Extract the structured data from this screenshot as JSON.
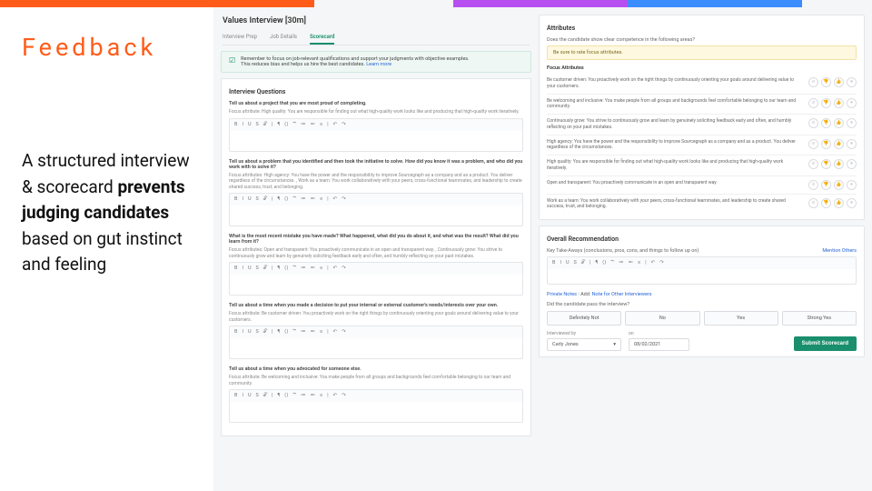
{
  "topbar": {
    "c1": "#ff5c1a",
    "c2": "#b74ff0",
    "c3": "#3a8cff"
  },
  "slide": {
    "title": "Feedback",
    "body_prefix": "A structured interview & scorecard ",
    "body_bold": "prevents judging candidates",
    "body_suffix": " based on gut instinct and feeling"
  },
  "app": {
    "title": "Values Interview [30m]",
    "tabs": [
      "Interview Prep",
      "Job Details",
      "Scorecard"
    ],
    "active_tab": 2,
    "info_line1": "Remember to focus on job-relevant qualifications and support your judgments with objective examples.",
    "info_line2": "This reduces bias and helps us hire the best candidates.",
    "learn_more": "Learn more",
    "iq_head": "Interview Questions",
    "questions": [
      {
        "q": "Tell us about a project that you are most proud of completing.",
        "sub": "Focus attribute: High quality: You are responsible for finding out what high-quality work looks like and producing that high-quality work iteratively."
      },
      {
        "q": "Tell us about a problem that you identified and then took the initiative to solve. How did you know it was a problem, and who did you work with to solve it?",
        "sub": "Focus attributes: High agency: You have the power and the responsibility to improve Sourcegraph as a company and as a product. You deliver regardless of the circumstances. , Work as a team: You work collaboratively with your peers, cross-functional teammates, and leadership to create shared success, trust, and belonging."
      },
      {
        "q": "What is the most recent mistake you have made? What happened, what did you do about it, and what was the result? What did you learn from it?",
        "sub": "Focus attributes: Open and transparent: You proactively communicate in an open and transparent way. , Continuously grow: You strive to continuously grow and learn by genuinely soliciting feedback early and often, and humbly reflecting on your past mistakes."
      },
      {
        "q": "Tell us about a time when you made a decision to put your internal or external customer's needs/interests over your own.",
        "sub": "Focus attribute: Be customer driven: You proactively work on the right things by continuously orienting your goals around delivering value to your customers."
      },
      {
        "q": "Tell us about a time when you advocated for someone else.",
        "sub": "Focus attribute: Be welcoming and inclusive: You make people from all groups and backgrounds feel comfortable belonging to our team and community."
      }
    ],
    "toolbar_icons": [
      "B",
      "I",
      "U",
      "S",
      "𝒯",
      "|",
      "¶",
      "⟨⟩",
      "“”",
      "≔",
      "≕",
      "≡",
      "|",
      "↶",
      "↷"
    ]
  },
  "attr": {
    "head": "Attributes",
    "prompt": "Does the candidate show clear competence in the following areas?",
    "warn": "Be sure to rate focus attributes.",
    "focus_head": "Focus Attributes",
    "rows": [
      "Be customer driven: You proactively work on the right things by continuously orienting your goals around delivering value to your customers.",
      "Be welcoming and inclusive: You make people from all groups and backgrounds feel comfortable belonging to our team and community.",
      "Continuously grow: You strive to continuously grow and learn by genuinely soliciting feedback early and often, and humbly reflecting on your past mistakes.",
      "High agency: You have the power and the responsibility to improve Sourcegraph as a company and as a product. You deliver regardless of the circumstances.",
      "High quality: You are responsible for finding out what high-quality work looks like and producing that high-quality work iteratively.",
      "Open and transparent: You proactively communicate in an open and transparent way.",
      "Work as a team: You work collaboratively with your peers, cross-functional teammates, and leadership to create shared success, trust, and belonging."
    ],
    "rating_glyphs": [
      "⊘",
      "👎",
      "👍",
      "★"
    ]
  },
  "rec": {
    "head": "Overall Recommendation",
    "key_label": "Key Take-Aways (conclusions, pros, cons, and things to follow up on)",
    "mention": "Mention Others",
    "private": "Private Notes",
    "add": "Add:",
    "note_other": "Note for Other Interviewers",
    "pass_q": "Did the candidate pass the interview?",
    "pass_opts": [
      "Definitely Not",
      "No",
      "Yes",
      "Strong Yes"
    ],
    "interviewed_by_label": "Interviewed by",
    "interviewer": "Carly Jones",
    "on_label": "on",
    "date": "08/02/2021",
    "submit": "Submit Scorecard"
  }
}
